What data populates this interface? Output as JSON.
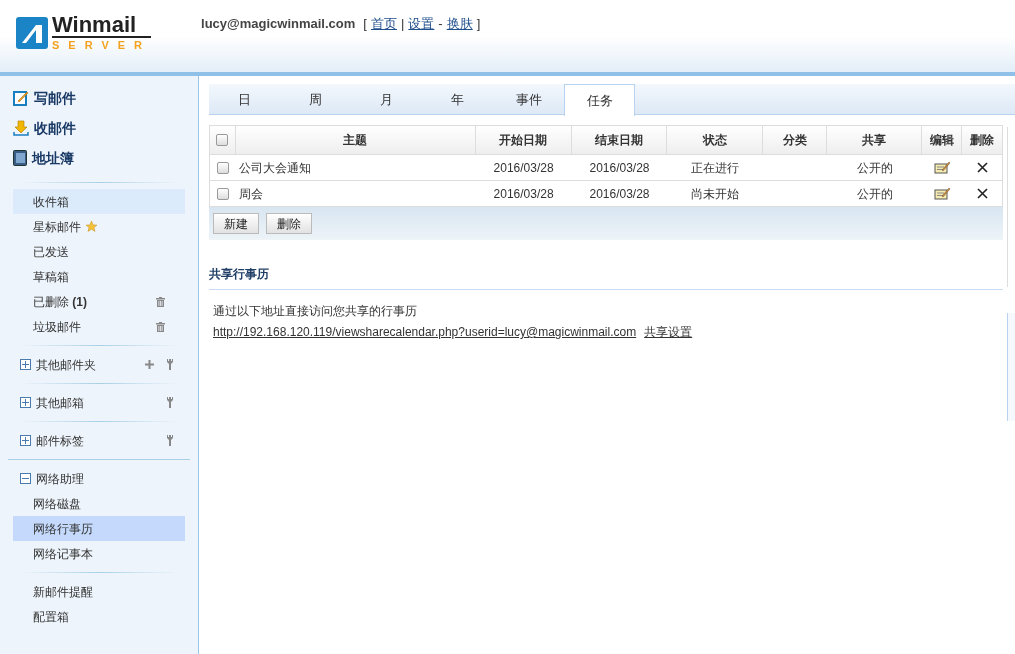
{
  "header": {
    "logo": {
      "name": "Winmail",
      "sub": "SERVER"
    },
    "user": "lucy@magicwinmail.com",
    "nav": [
      {
        "kind": "text",
        "text": "["
      },
      {
        "kind": "link",
        "text": "首页"
      },
      {
        "kind": "text",
        "text": "|"
      },
      {
        "kind": "link",
        "text": "设置"
      },
      {
        "kind": "text",
        "text": "-"
      },
      {
        "kind": "link",
        "text": "换肤"
      },
      {
        "kind": "text",
        "text": "]"
      }
    ]
  },
  "sidebar": {
    "actions": [
      {
        "kind": "compose",
        "label": "写邮件"
      },
      {
        "kind": "receive",
        "label": "收邮件"
      },
      {
        "kind": "contacts",
        "label": "地址簿"
      }
    ],
    "folders": [
      {
        "label": "收件箱",
        "selected": true
      },
      {
        "label": "星标邮件",
        "selected": false,
        "kind": "starred"
      },
      {
        "label": "已发送",
        "selected": false
      },
      {
        "label": "草稿箱",
        "selected": false
      },
      {
        "label": "已删除 **(1)**",
        "selected": false,
        "kind": "emptiable"
      },
      {
        "label": "垃圾邮件",
        "selected": false,
        "kind": "emptiable"
      }
    ],
    "groups": [
      {
        "label": "其他邮件夹",
        "expanded": false,
        "kind": "addable"
      },
      {
        "label": "其他邮箱",
        "expanded": false,
        "kind": "managed"
      },
      {
        "label": "邮件标签",
        "expanded": false,
        "kind": "managed"
      },
      {
        "label": "网络助理",
        "expanded": true,
        "kind": "plain",
        "children": [
          {
            "label": "网络磁盘",
            "selected": false
          },
          {
            "label": "网络行事历",
            "selected": true
          },
          {
            "label": "网络记事本",
            "selected": false
          }
        ]
      }
    ],
    "extras": [
      {
        "label": "新邮件提醒"
      },
      {
        "label": "配置箱"
      }
    ]
  },
  "tabs": [
    {
      "label": "日",
      "selected": false
    },
    {
      "label": "周",
      "selected": false
    },
    {
      "label": "月",
      "selected": false
    },
    {
      "label": "年",
      "selected": false
    },
    {
      "label": "事件",
      "selected": false
    },
    {
      "label": "任务",
      "selected": true
    }
  ],
  "table": {
    "select_all": {
      "checked": false
    },
    "columns": [
      "主题",
      "开始日期",
      "结束日期",
      "状态",
      "分类",
      "共享",
      "编辑",
      "删除"
    ],
    "rows": [
      {
        "checked": false,
        "subject": "公司大会通知",
        "start": "2016/03/28",
        "end": "2016/03/28",
        "status": "正在进行",
        "share": "公开的"
      },
      {
        "checked": false,
        "subject": "周会",
        "start": "2016/03/28",
        "end": "2016/03/28",
        "status": "尚未开始",
        "share": "公开的"
      }
    ]
  },
  "buttons": [
    "新建",
    "删除"
  ],
  "share": {
    "title": "共享行事历",
    "text": "通过以下地址直接访问您共享的行事历",
    "url": "http://192.168.120.119/viewsharecalendar.php?userid=lucy@magicwinmail.com",
    "settings_link": "共享设置"
  }
}
